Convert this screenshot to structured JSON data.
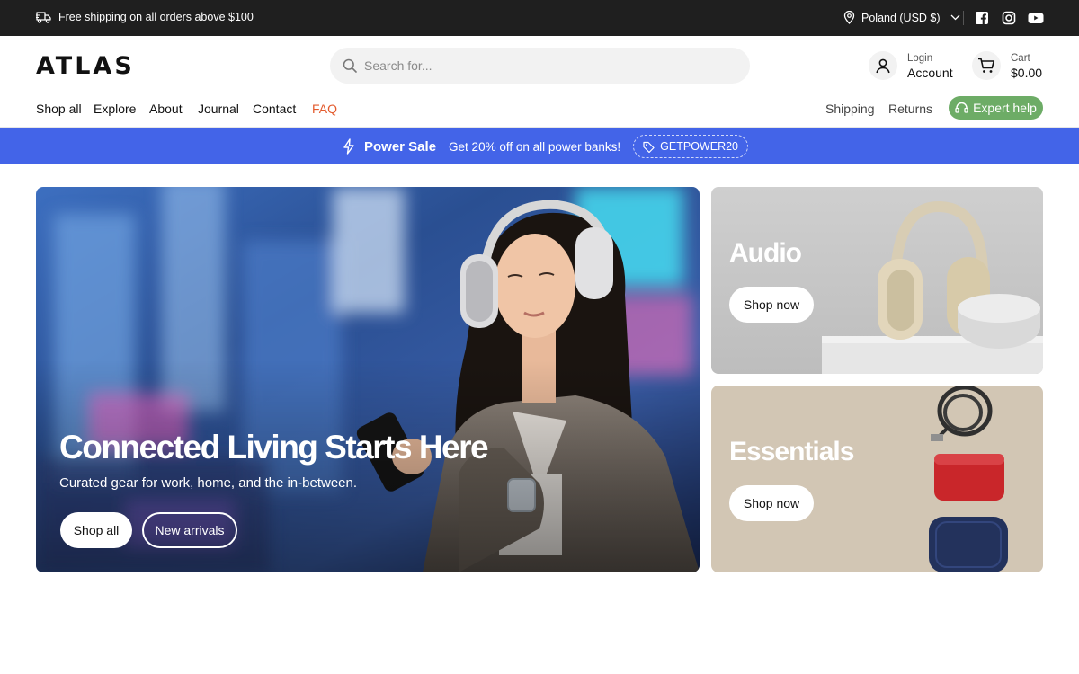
{
  "topbar": {
    "shipping_text": "Free shipping on all orders above $100",
    "region": "Poland (USD $)",
    "social": [
      "facebook-icon",
      "instagram-icon",
      "youtube-icon"
    ]
  },
  "header": {
    "logo": "ATLAS",
    "search_placeholder": "Search for...",
    "account": {
      "small": "Login",
      "big": "Account"
    },
    "cart": {
      "small": "Cart",
      "big": "$0.00"
    }
  },
  "nav": {
    "left": [
      "Shop all",
      "Explore",
      "About",
      "Journal",
      "Contact",
      "FAQ"
    ],
    "right": [
      "Shipping",
      "Returns"
    ],
    "expert_label": "Expert help"
  },
  "promo": {
    "title": "Power Sale",
    "description": "Get 20% off on all power banks!",
    "code": "GETPOWER20"
  },
  "hero": {
    "title": "Connected Living Starts Here",
    "subtitle": "Curated gear for work, home, and the in-between.",
    "primary_button": "Shop all",
    "secondary_button": "New arrivals"
  },
  "cards": [
    {
      "title": "Audio",
      "button": "Shop now"
    },
    {
      "title": "Essentials",
      "button": "Shop now"
    }
  ],
  "colors": {
    "topbar": "#1f1f1f",
    "promo": "#4364e8",
    "accent_faq": "#e35b2e",
    "expert_green": "#6dac66"
  }
}
